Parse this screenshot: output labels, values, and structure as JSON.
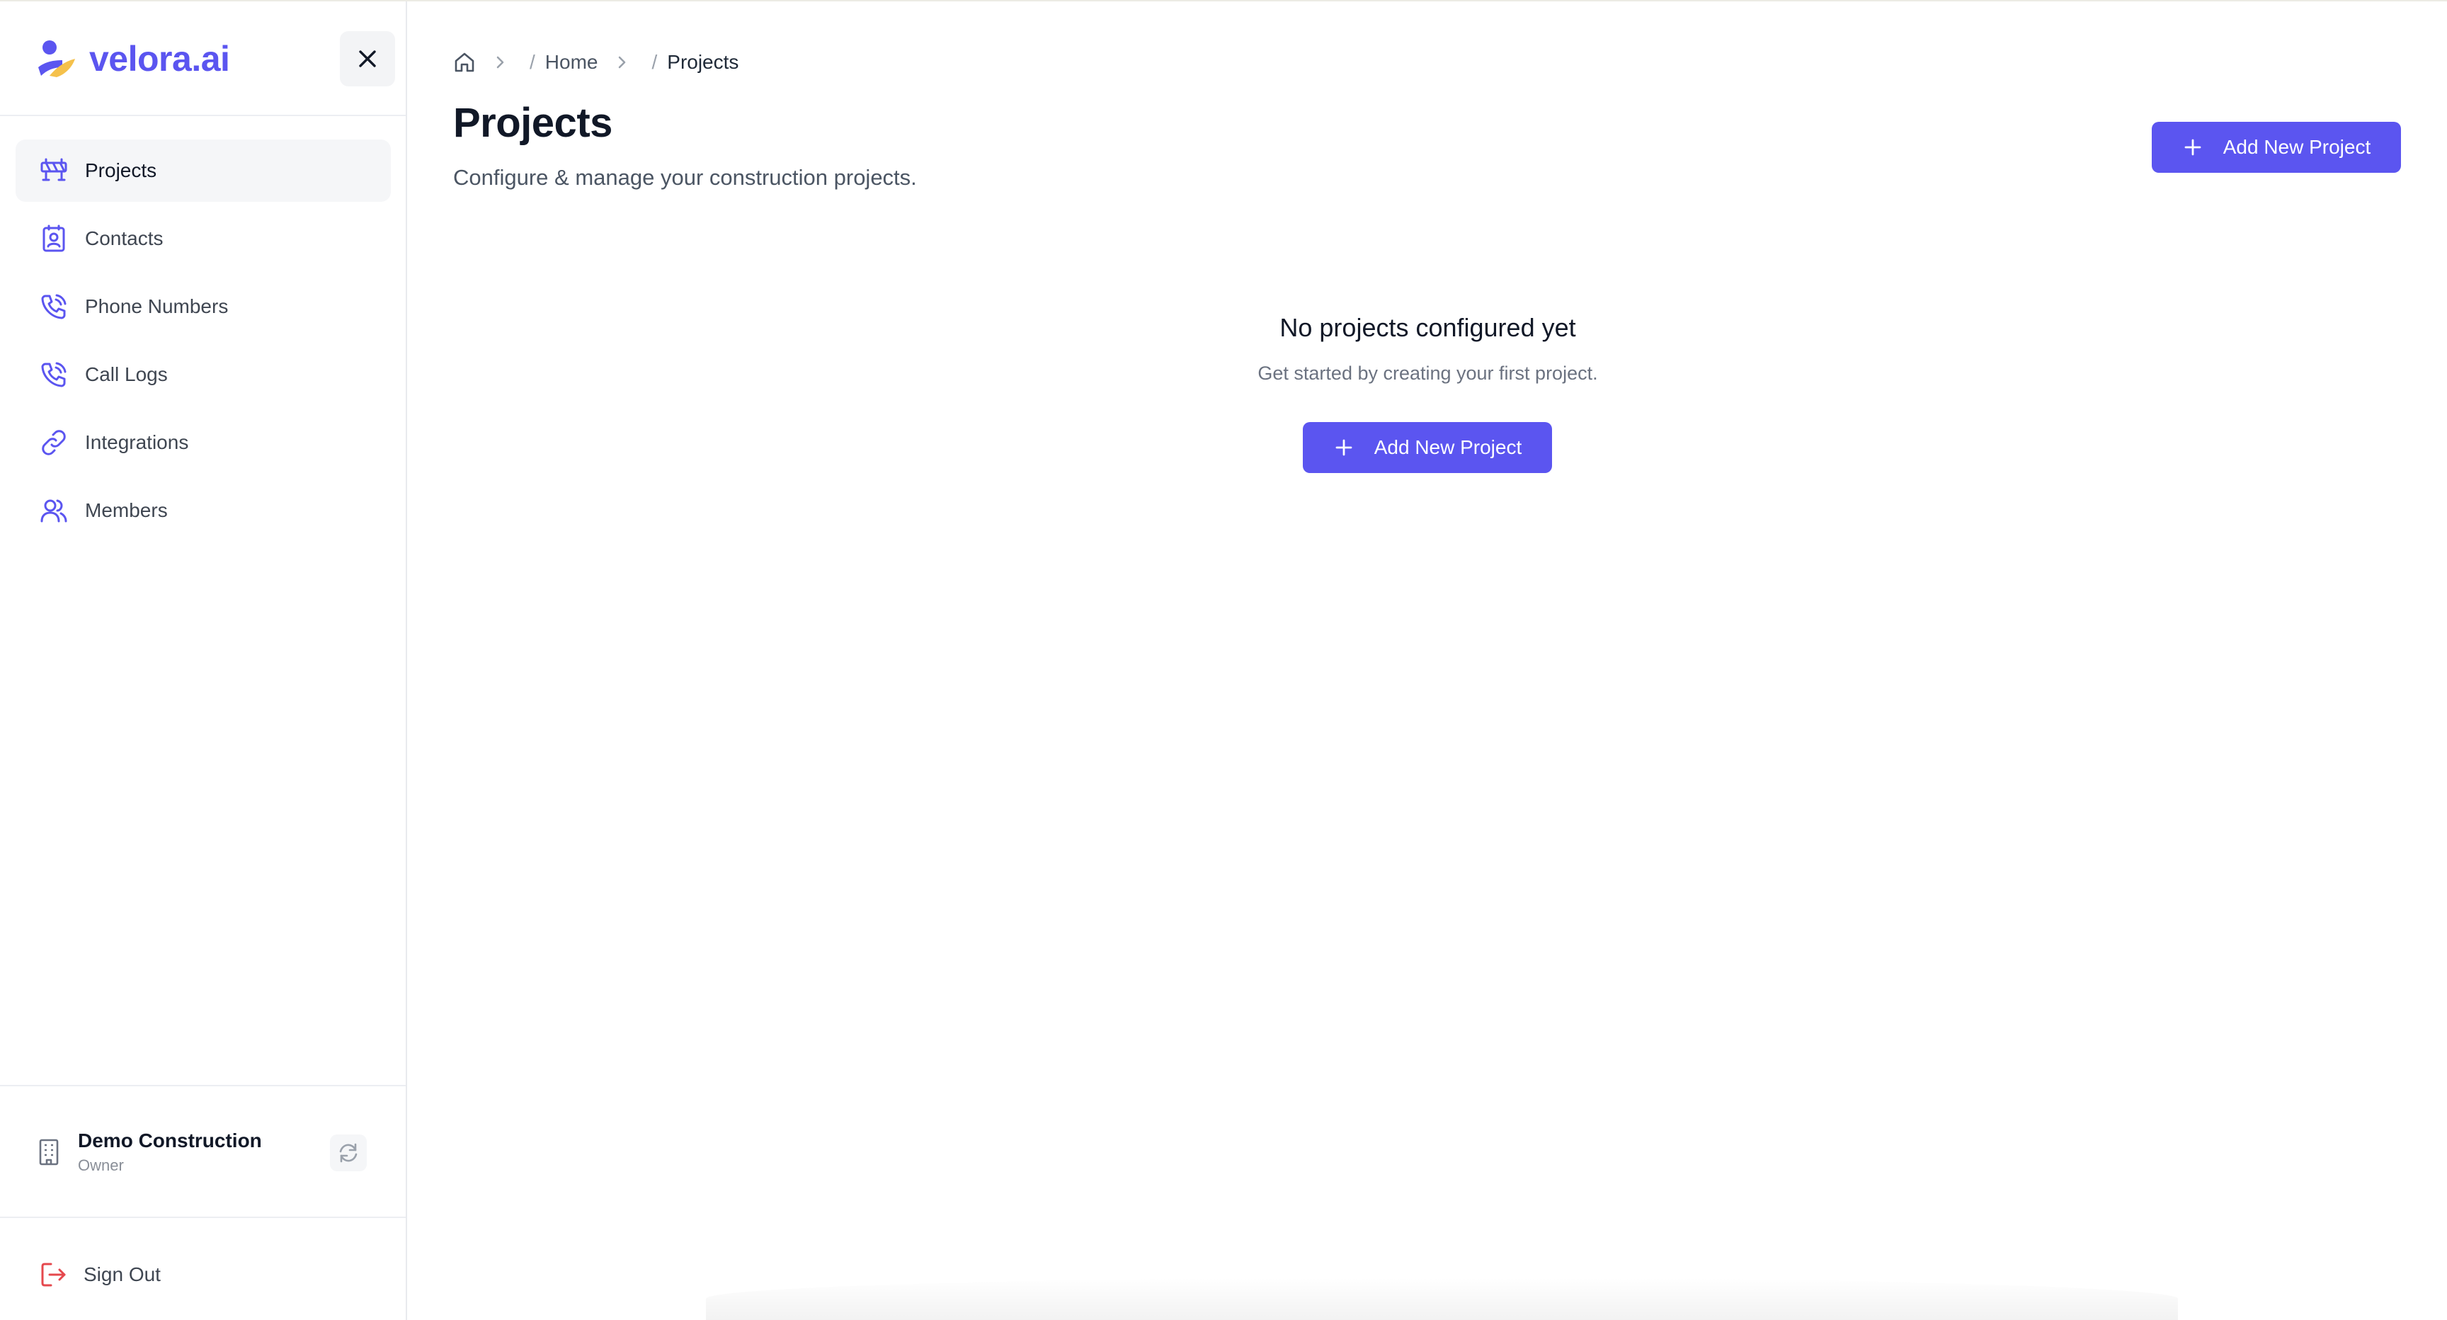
{
  "brand": {
    "name": "velora.ai",
    "color": "#5b55f0"
  },
  "sidebar": {
    "items": [
      {
        "label": "Projects",
        "icon": "barrier-icon",
        "active": true
      },
      {
        "label": "Contacts",
        "icon": "contact-card-icon",
        "active": false
      },
      {
        "label": "Phone Numbers",
        "icon": "phone-icon",
        "active": false
      },
      {
        "label": "Call Logs",
        "icon": "phone-icon",
        "active": false
      },
      {
        "label": "Integrations",
        "icon": "link-icon",
        "active": false
      },
      {
        "label": "Members",
        "icon": "users-icon",
        "active": false
      }
    ],
    "organization": {
      "name": "Demo Construction",
      "role": "Owner"
    },
    "sign_out_label": "Sign Out"
  },
  "breadcrumb": {
    "separator": "/",
    "items": [
      "Home",
      "Projects"
    ]
  },
  "page": {
    "title": "Projects",
    "subtitle": "Configure & manage your construction projects.",
    "add_button_label": "Add New Project"
  },
  "empty_state": {
    "title": "No projects configured yet",
    "subtitle": "Get started by creating your first project.",
    "button_label": "Add New Project"
  },
  "colors": {
    "accent": "#5b55f0",
    "danger": "#e5484d",
    "logo_yellow": "#f5c14b"
  }
}
